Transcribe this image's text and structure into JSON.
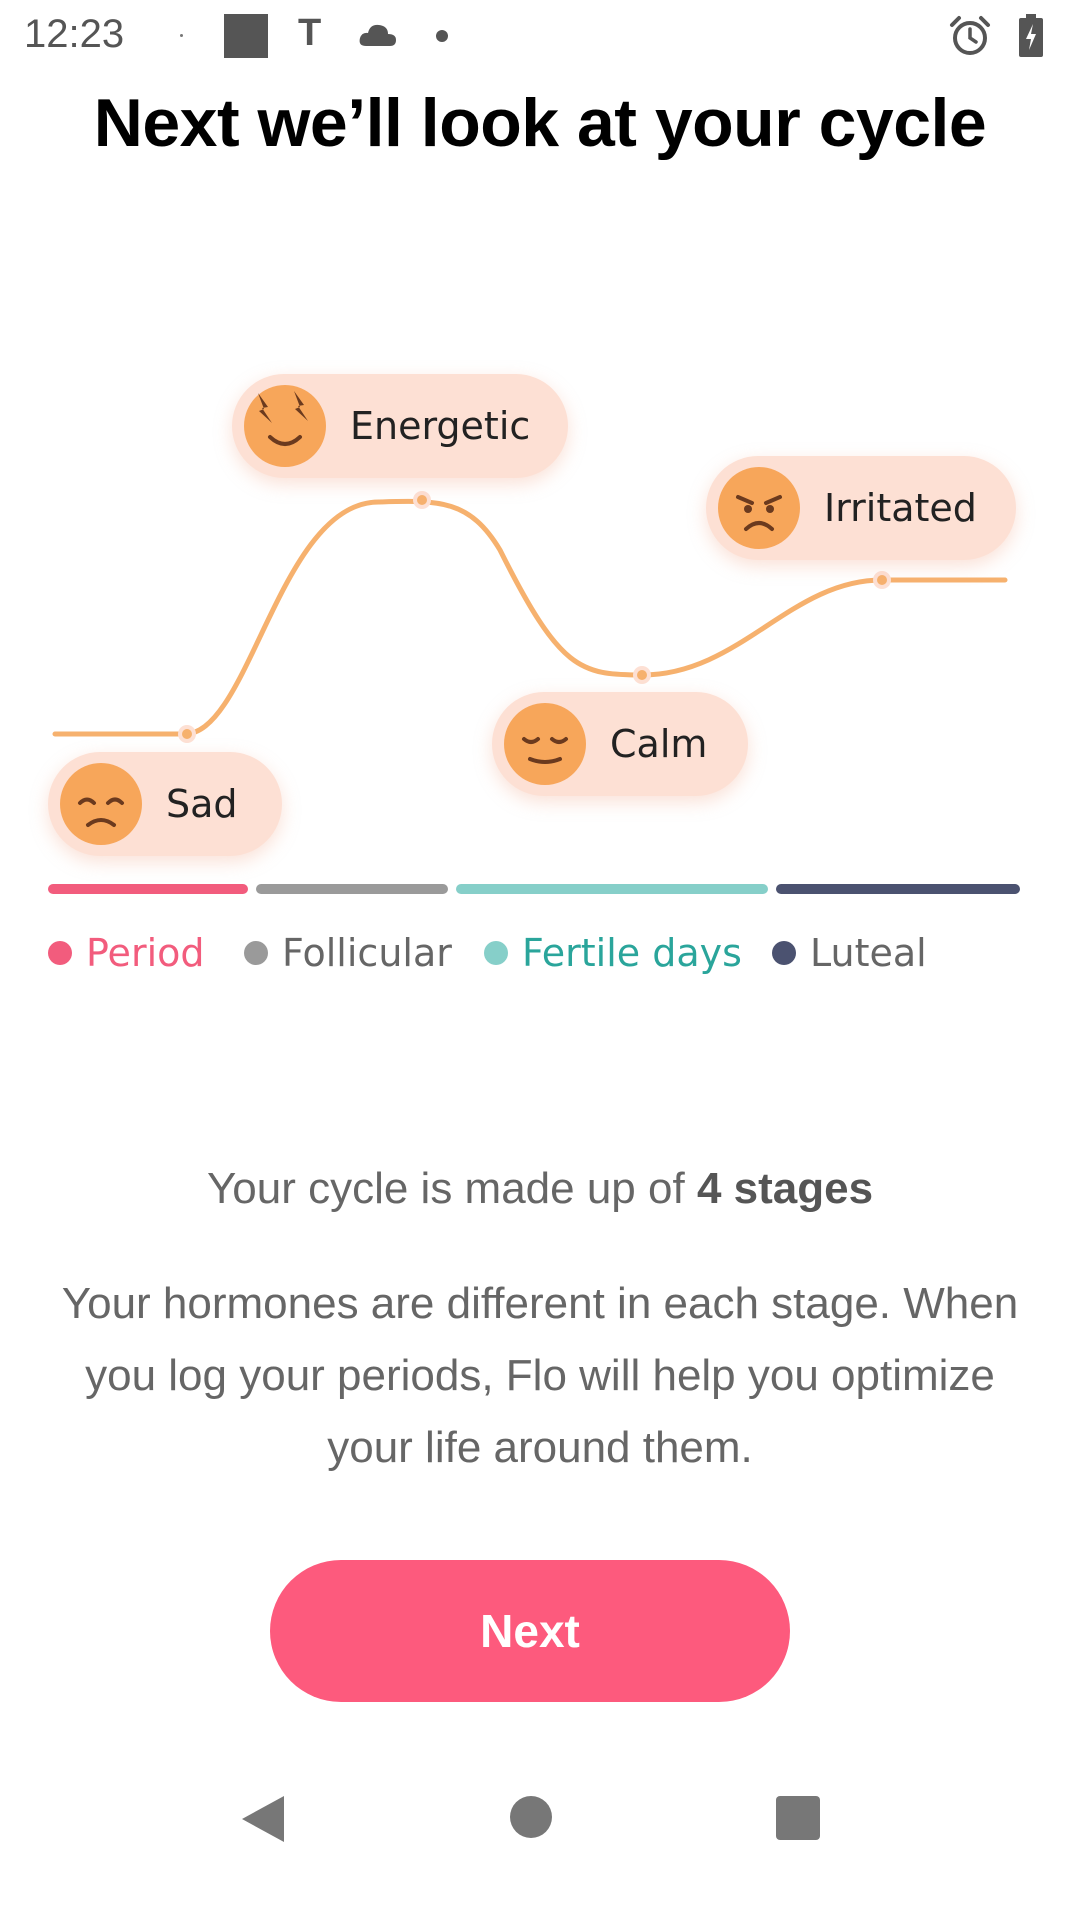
{
  "status_bar": {
    "time": "12:23",
    "icons": [
      "small-dot-icon",
      "square-notification-icon",
      "t-letter-icon",
      "cloud-icon",
      "dot-icon",
      "alarm-icon",
      "battery-charging-icon"
    ]
  },
  "title": "Next we’ll look at your cycle",
  "moods": [
    {
      "label": "Sad",
      "icon": "sad-face-icon"
    },
    {
      "label": "Energetic",
      "icon": "energetic-face-icon"
    },
    {
      "label": "Calm",
      "icon": "calm-face-icon"
    },
    {
      "label": "Irritated",
      "icon": "irritated-face-icon"
    }
  ],
  "phases": [
    {
      "label": "Period",
      "color": "#f25c7d"
    },
    {
      "label": "Follicular",
      "color": "#9a9a9a"
    },
    {
      "label": "Fertile days",
      "color": "#86cfc9"
    },
    {
      "label": "Luteal",
      "color": "#4b5270"
    }
  ],
  "colors": {
    "accent": "#fd5a7d",
    "curve": "#f6b16e",
    "pill_bg": "#fde0d4",
    "face": "#f7a65a"
  },
  "subhead": {
    "prefix": "Your cycle is made up of ",
    "bold": "4 stages"
  },
  "body_text": "Your hormones are different in each stage. When you log your periods, Flo will help you optimize your life around them.",
  "next_button": "Next",
  "nav": {
    "back": "back-triangle-icon",
    "home": "home-circle-icon",
    "recents": "recents-square-icon"
  }
}
